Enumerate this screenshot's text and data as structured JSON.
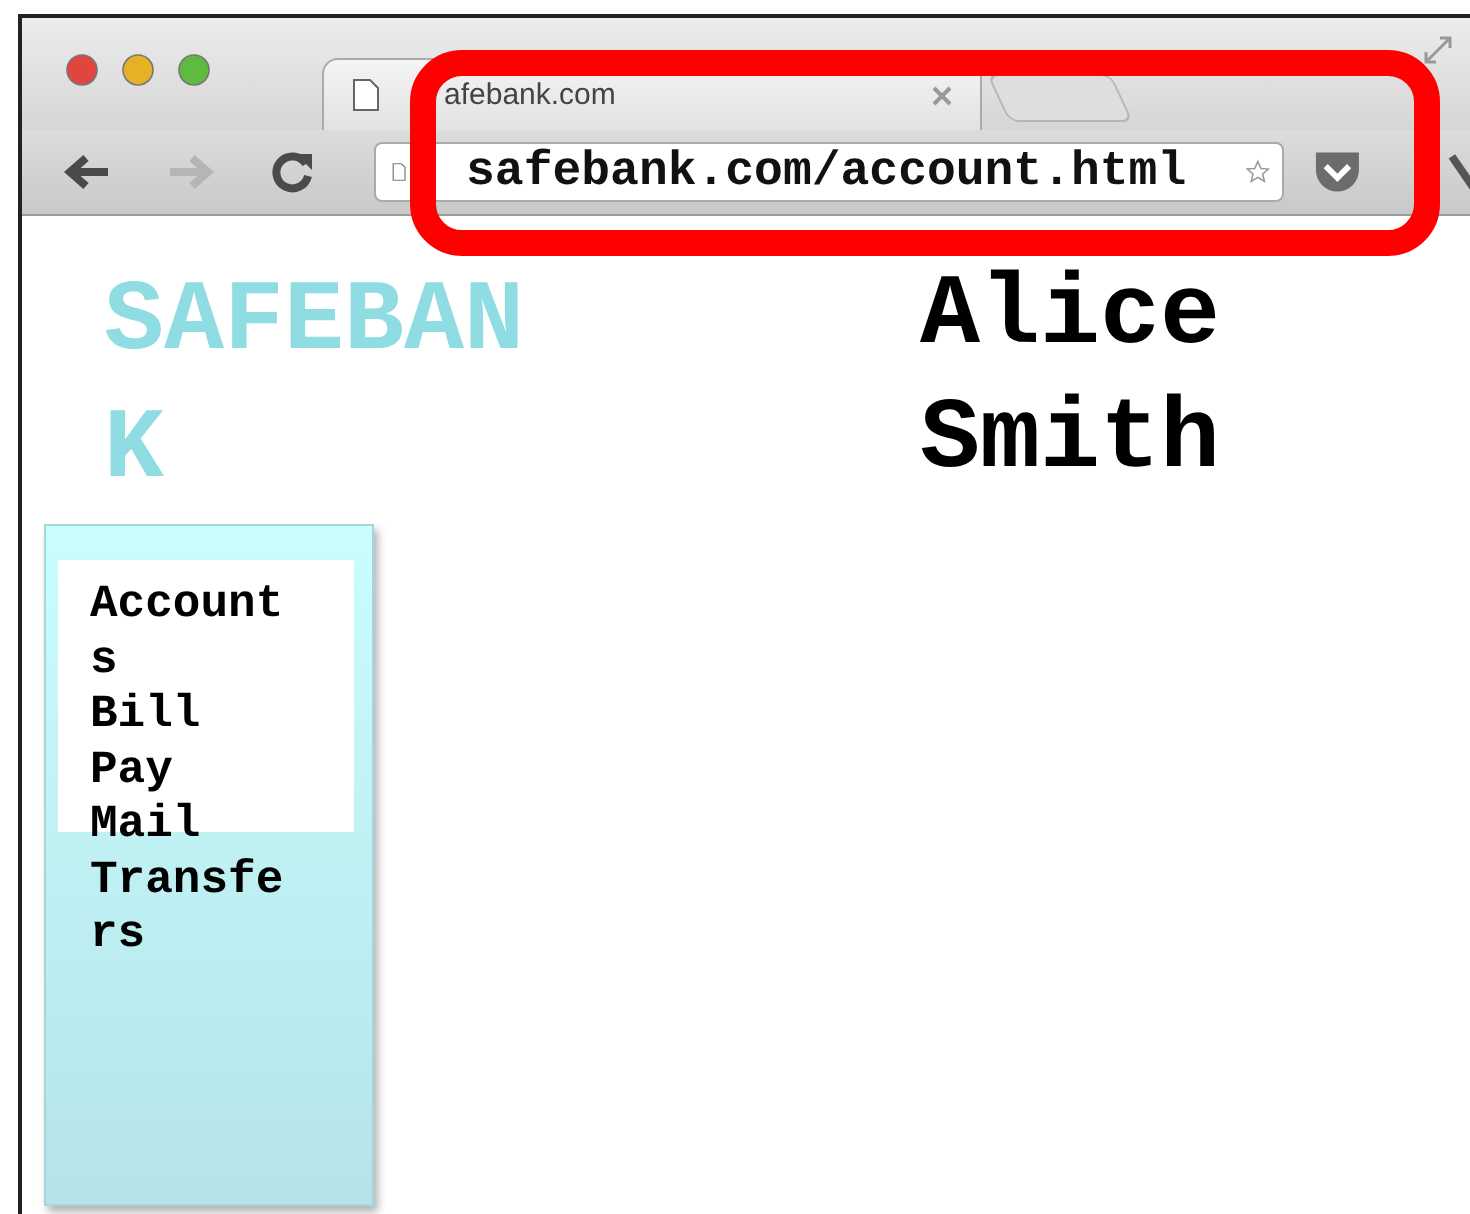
{
  "browser": {
    "tab": {
      "title": "afebank.com"
    },
    "toolbar_buttons": [
      {
        "kind": "back",
        "disabled": false
      },
      {
        "kind": "forward",
        "disabled": true
      },
      {
        "kind": "reload",
        "disabled": false
      }
    ],
    "address_bar": {
      "value": "safebank.com/account.html"
    }
  },
  "page": {
    "logo": "SAFEBANK",
    "user_name": "Alice Smith",
    "nav_items": [
      "Accounts",
      "Bill Pay",
      "Mail",
      "Transfers"
    ]
  }
}
